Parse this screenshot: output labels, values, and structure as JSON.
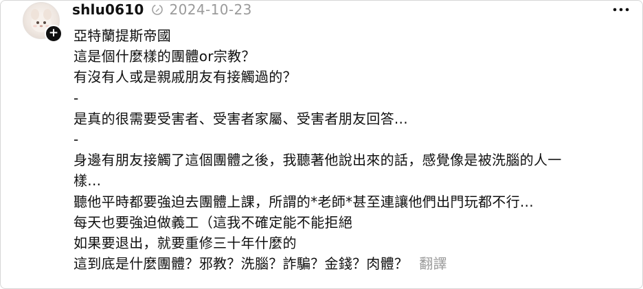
{
  "post": {
    "username": "shlu0610",
    "timestamp": "2024-10-23",
    "follow_symbol": "+",
    "lines": [
      "亞特蘭提斯帝國",
      "這是個什麼樣的團體or宗教？",
      "有沒有人或是親戚朋友有接觸過的？",
      "-",
      "是真的很需要受害者、受害者家屬、受害者朋友回答...",
      "-",
      "身邊有朋友接觸了這個團體之後，我聽著他說出來的話，感覺像是被洗腦的人一",
      "樣...",
      "聽他平時都要強迫去團體上課，所謂的*老師*甚至連讓他們出門玩都不行...",
      "每天也要強迫做義工（這我不確定能不能拒絕",
      "如果要退出，就要重修三十年什麼的",
      "這到底是什麼團體？邪教？洗腦？詐騙？金錢？肉體？"
    ],
    "translate_label": "翻譯"
  },
  "icons": {
    "edit": "edited-icon",
    "more": "more-options-icon",
    "avatar": "avatar-image"
  },
  "colors": {
    "text": "#101010",
    "muted": "#9a9a9a",
    "badge": "#101010"
  }
}
